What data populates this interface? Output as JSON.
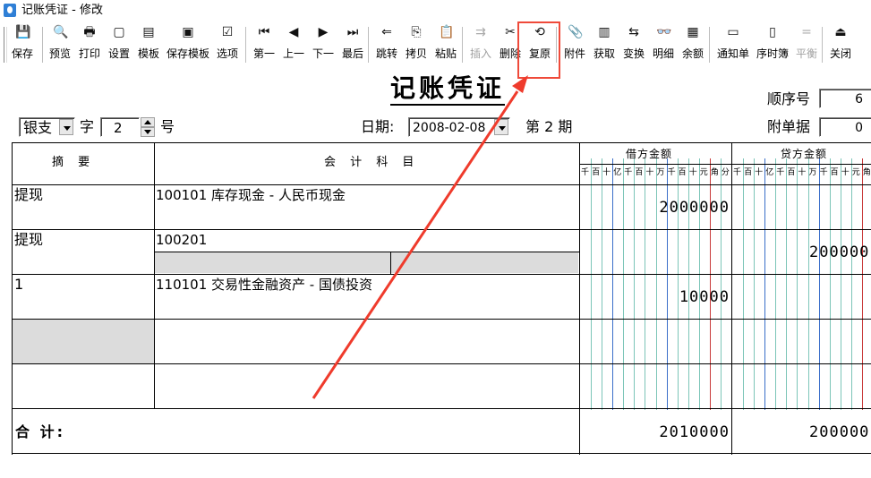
{
  "window": {
    "title": "记账凭证 - 修改"
  },
  "toolbar": {
    "items": [
      {
        "label": "保存",
        "icon": "save-icon",
        "enabled": true
      },
      {
        "label": "预览",
        "icon": "preview-icon",
        "enabled": true
      },
      {
        "label": "打印",
        "icon": "print-icon",
        "enabled": true
      },
      {
        "label": "设置",
        "icon": "settings-icon",
        "enabled": true
      },
      {
        "label": "模板",
        "icon": "template-icon",
        "enabled": true
      },
      {
        "label": "保存模板",
        "icon": "save-template-icon",
        "enabled": true
      },
      {
        "label": "选项",
        "icon": "options-icon",
        "enabled": true
      },
      {
        "label": "第一",
        "icon": "first-icon",
        "enabled": true
      },
      {
        "label": "上一",
        "icon": "prev-icon",
        "enabled": true
      },
      {
        "label": "下一",
        "icon": "next-icon",
        "enabled": true
      },
      {
        "label": "最后",
        "icon": "last-icon",
        "enabled": true
      },
      {
        "label": "跳转",
        "icon": "jump-icon",
        "enabled": true
      },
      {
        "label": "拷贝",
        "icon": "copy-icon",
        "enabled": true
      },
      {
        "label": "粘贴",
        "icon": "paste-icon",
        "enabled": true
      },
      {
        "label": "插入",
        "icon": "insert-icon",
        "enabled": false
      },
      {
        "label": "删除",
        "icon": "delete-icon",
        "enabled": true
      },
      {
        "label": "复原",
        "icon": "restore-icon",
        "enabled": true
      },
      {
        "label": "附件",
        "icon": "attachment-icon",
        "enabled": true
      },
      {
        "label": "获取",
        "icon": "fetch-icon",
        "enabled": true
      },
      {
        "label": "变换",
        "icon": "transform-icon",
        "enabled": true
      },
      {
        "label": "明细",
        "icon": "detail-icon",
        "enabled": true
      },
      {
        "label": "余额",
        "icon": "balance-icon",
        "enabled": true
      },
      {
        "label": "通知单",
        "icon": "notice-icon",
        "enabled": true
      },
      {
        "label": "序时簿",
        "icon": "journal-icon",
        "enabled": true
      },
      {
        "label": "平衡",
        "icon": "balance-check-icon",
        "enabled": false
      },
      {
        "label": "关闭",
        "icon": "close-icon",
        "enabled": true
      }
    ]
  },
  "voucher": {
    "title": "记账凭证",
    "type_value": "银支",
    "word_label": "字",
    "number_value": "2",
    "number_suffix": "号",
    "date_label": "日期:",
    "date_value": "2008-02-08",
    "period_label": "第 2 期",
    "seq_label": "顺序号",
    "seq_value": "6",
    "attach_label": "附单据",
    "attach_value": "0"
  },
  "table": {
    "headers": {
      "summary": "摘 要",
      "account": "会 计 科 目",
      "debit": "借方金额",
      "credit": "贷方金额"
    },
    "digit_units": [
      "千",
      "百",
      "十",
      "亿",
      "千",
      "百",
      "十",
      "万",
      "千",
      "百",
      "十",
      "元",
      "角",
      "分"
    ],
    "rows": [
      {
        "summary": "提现",
        "account": "100101 库存现金 - 人民币现金",
        "debit": "2000000",
        "credit": ""
      },
      {
        "summary": "提现",
        "account": "100201",
        "debit": "",
        "credit": "200000"
      },
      {
        "summary": "1",
        "account": "110101 交易性金融资产 - 国债投资",
        "debit": "10000",
        "credit": ""
      },
      {
        "summary": "",
        "account": "",
        "debit": "",
        "credit": ""
      },
      {
        "summary": "",
        "account": "",
        "debit": "",
        "credit": ""
      }
    ],
    "total_label": "合 计:",
    "total_debit": "2010000",
    "total_credit": "200000"
  }
}
